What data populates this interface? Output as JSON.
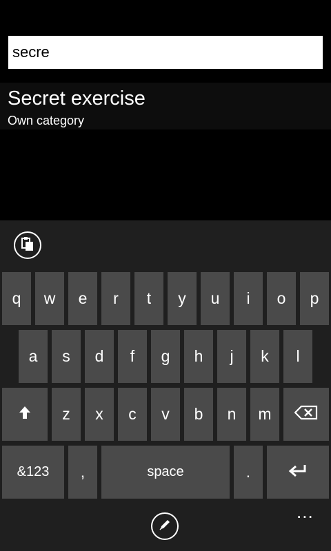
{
  "search": {
    "value": "secre"
  },
  "results": [
    {
      "title": "Secret exercise",
      "subtitle": "Own category"
    }
  ],
  "keyboard": {
    "row1": [
      "q",
      "w",
      "e",
      "r",
      "t",
      "y",
      "u",
      "i",
      "o",
      "p"
    ],
    "row2": [
      "a",
      "s",
      "d",
      "f",
      "g",
      "h",
      "j",
      "k",
      "l"
    ],
    "row3": [
      "z",
      "x",
      "c",
      "v",
      "b",
      "n",
      "m"
    ],
    "symbols_label": "&123",
    "comma_label": ",",
    "space_label": "space",
    "period_label": ".",
    "more_label": "..."
  },
  "icons": {
    "clipboard": "clipboard-icon",
    "shift": "shift-arrow-icon",
    "backspace": "backspace-icon",
    "enter": "enter-icon",
    "pen": "pen-icon"
  },
  "colors": {
    "background": "#000000",
    "keyboard_bg": "#1f1f1f",
    "key_bg": "#4a4a4a",
    "result_bg": "#0d0d0d"
  }
}
